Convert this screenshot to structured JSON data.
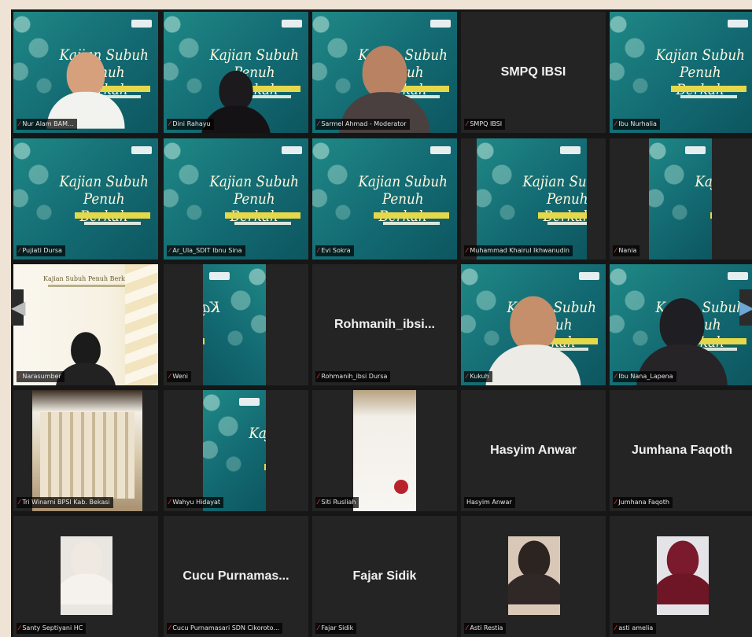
{
  "poster": {
    "title": "Kajian Subuh\nPenuh Berkah",
    "white_title": "Kajian Subuh Penuh Berkah"
  },
  "tiles": [
    {
      "name": "Nur Alam BAM...",
      "center_name": "",
      "kind": "poster-person",
      "speaking": true
    },
    {
      "name": "Dini Rahayu",
      "center_name": "",
      "kind": "poster-hijab"
    },
    {
      "name": "Sarmel Ahmad - Moderator",
      "center_name": "",
      "kind": "poster-moderator"
    },
    {
      "name": "SMPQ IBSI",
      "center_name": "SMPQ IBSI",
      "kind": "text"
    },
    {
      "name": "Ibu Nurhalia",
      "center_name": "",
      "kind": "poster"
    },
    {
      "name": "Pujiati Dursa",
      "center_name": "",
      "kind": "poster"
    },
    {
      "name": "Ar_Ula_SDIT Ibnu Sina",
      "center_name": "",
      "kind": "poster"
    },
    {
      "name": "Evi Sokra",
      "center_name": "",
      "kind": "poster"
    },
    {
      "name": "Muhammad Khairul Ikhwanudin",
      "center_name": "",
      "kind": "poster-narrow"
    },
    {
      "name": "Nania",
      "center_name": "",
      "kind": "poster-narrower"
    },
    {
      "name": "Narasumber",
      "center_name": "",
      "kind": "white-poster"
    },
    {
      "name": "Weni",
      "center_name": "",
      "kind": "poster-mirror"
    },
    {
      "name": "Rohmanih_ibsi Dursa",
      "center_name": "Rohmanih_ibsi...",
      "kind": "text"
    },
    {
      "name": "Kukuh",
      "center_name": "",
      "kind": "poster-ustadz"
    },
    {
      "name": "Ibu Nana_Lapena",
      "center_name": "",
      "kind": "poster-hijab2"
    },
    {
      "name": "Tri Winarni BPSI Kab. Bekasi",
      "center_name": "",
      "kind": "room"
    },
    {
      "name": "Wahyu Hidayat",
      "center_name": "",
      "kind": "poster-narrow2"
    },
    {
      "name": "Siti Rusliah",
      "center_name": "",
      "kind": "wall"
    },
    {
      "name": "Hasyim Anwar",
      "center_name": "Hasyim Anwar",
      "kind": "text",
      "muted_hidden": true
    },
    {
      "name": "Jumhana Faqoth",
      "center_name": "Jumhana Faqoth",
      "kind": "text"
    },
    {
      "name": "Santy Septiyani HC",
      "center_name": "",
      "kind": "photo-white"
    },
    {
      "name": "Cucu Purnamasari SDN Cikoroto...",
      "center_name": "Cucu Purnamas...",
      "kind": "text"
    },
    {
      "name": "Fajar Sidik",
      "center_name": "Fajar Sidik",
      "kind": "text"
    },
    {
      "name": "Asti Restia",
      "center_name": "",
      "kind": "photo-dark"
    },
    {
      "name": "asti amelia",
      "center_name": "",
      "kind": "photo-maroon"
    }
  ],
  "nav": {
    "prev_icon": "chevron-left-icon",
    "next_icon": "chevron-right-icon",
    "prev_glyph": "◀",
    "next_glyph": "▶"
  },
  "colors": {
    "speaking_outline": "#c9d23a",
    "muted_icon": "#e13434",
    "poster_teal": "#1f8886"
  },
  "mic_glyph": "⁄"
}
